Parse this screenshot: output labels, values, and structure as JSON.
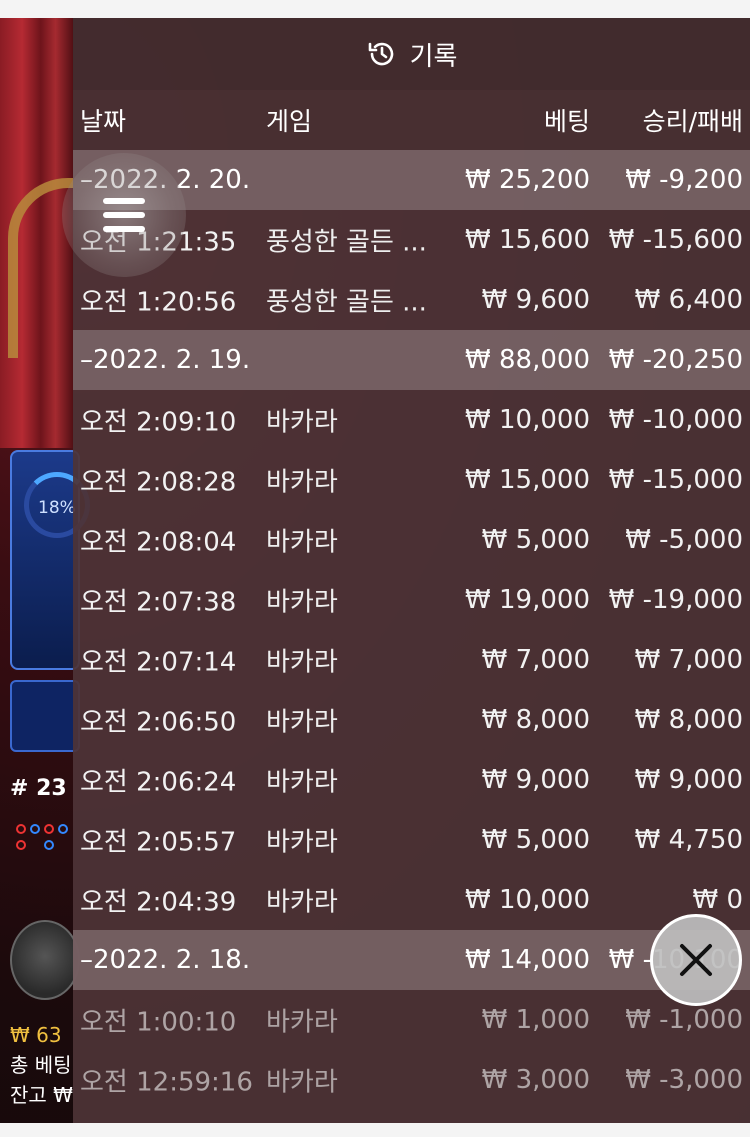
{
  "panel": {
    "title": "기록",
    "columns": {
      "date": "날짜",
      "game": "게임",
      "bet": "베팅",
      "win_loss": "승리/패배"
    }
  },
  "background": {
    "percent": "18%",
    "round": "# 23",
    "balance_line": "₩ 63",
    "total_bet_line": "총 베팅",
    "balance_label": "잔고 ₩"
  },
  "rows": [
    {
      "type": "group",
      "date": "–2022. 2. 20.",
      "game": "",
      "bet": "₩ 25,200",
      "win": "₩ -9,200"
    },
    {
      "type": "item",
      "date": "오전 1:21:35",
      "game": "풍성한 골든 ...",
      "bet": "₩ 15,600",
      "win": "₩ -15,600"
    },
    {
      "type": "item",
      "date": "오전 1:20:56",
      "game": "풍성한 골든 ...",
      "bet": "₩ 9,600",
      "win": "₩ 6,400"
    },
    {
      "type": "group",
      "date": "–2022. 2. 19.",
      "game": "",
      "bet": "₩ 88,000",
      "win": "₩ -20,250"
    },
    {
      "type": "item",
      "date": "오전 2:09:10",
      "game": "바카라",
      "bet": "₩ 10,000",
      "win": "₩ -10,000"
    },
    {
      "type": "item",
      "date": "오전 2:08:28",
      "game": "바카라",
      "bet": "₩ 15,000",
      "win": "₩ -15,000"
    },
    {
      "type": "item",
      "date": "오전 2:08:04",
      "game": "바카라",
      "bet": "₩ 5,000",
      "win": "₩ -5,000"
    },
    {
      "type": "item",
      "date": "오전 2:07:38",
      "game": "바카라",
      "bet": "₩ 19,000",
      "win": "₩ -19,000"
    },
    {
      "type": "item",
      "date": "오전 2:07:14",
      "game": "바카라",
      "bet": "₩ 7,000",
      "win": "₩ 7,000"
    },
    {
      "type": "item",
      "date": "오전 2:06:50",
      "game": "바카라",
      "bet": "₩ 8,000",
      "win": "₩ 8,000"
    },
    {
      "type": "item",
      "date": "오전 2:06:24",
      "game": "바카라",
      "bet": "₩ 9,000",
      "win": "₩ 9,000"
    },
    {
      "type": "item",
      "date": "오전 2:05:57",
      "game": "바카라",
      "bet": "₩ 5,000",
      "win": "₩ 4,750"
    },
    {
      "type": "item",
      "date": "오전 2:04:39",
      "game": "바카라",
      "bet": "₩ 10,000",
      "win": "₩ 0"
    },
    {
      "type": "group",
      "date": "–2022. 2. 18.",
      "game": "",
      "bet": "₩ 14,000",
      "win": "₩ -10,100"
    },
    {
      "type": "item",
      "date": "오전 1:00:10",
      "game": "바카라",
      "bet": "₩ 1,000",
      "win": "₩ -1,000"
    },
    {
      "type": "item",
      "date": "오전 12:59:16",
      "game": "바카라",
      "bet": "₩ 3,000",
      "win": "₩ -3,000"
    }
  ],
  "icons": {
    "history": "history-clock-icon",
    "menu": "hamburger-menu-icon",
    "close": "close-x-icon"
  },
  "colors": {
    "panel_bg": "#4e3437",
    "group_row_bg": "#826e70",
    "text": "#ffffff"
  }
}
